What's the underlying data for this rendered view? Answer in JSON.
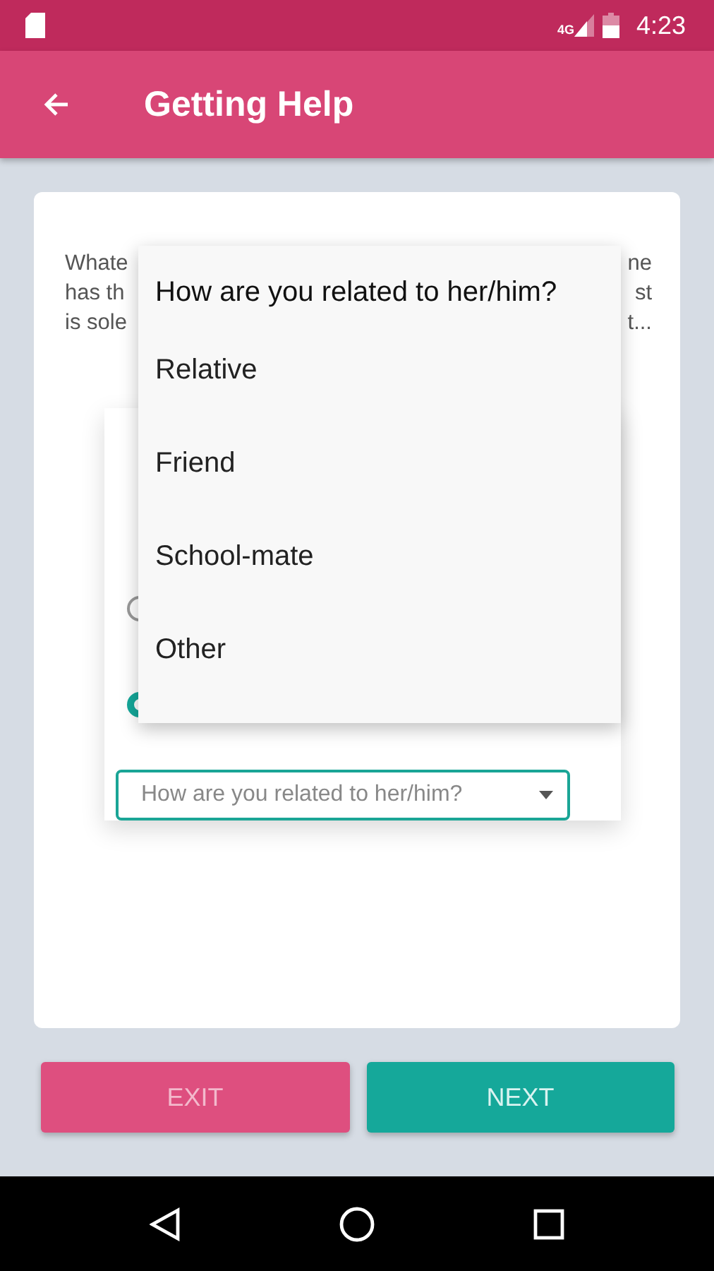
{
  "status_bar": {
    "time": "4:23",
    "network": "4G"
  },
  "app_bar": {
    "title": "Getting Help"
  },
  "intro": {
    "lines": [
      [
        "Whate",
        "ne"
      ],
      [
        "has th",
        "st"
      ],
      [
        "is sole",
        "t..."
      ]
    ]
  },
  "question": {
    "options": [
      {
        "selected": false
      },
      {
        "selected": true
      }
    ],
    "select": {
      "placeholder": "How are you related to her/him?"
    }
  },
  "dropdown": {
    "title": "How are you related to her/him?",
    "items": [
      "Relative",
      "Friend",
      "School-mate",
      "Other"
    ]
  },
  "buttons": [
    {
      "label": "EXIT",
      "kind": "secondary"
    },
    {
      "label": "NEXT",
      "kind": "primary"
    }
  ]
}
